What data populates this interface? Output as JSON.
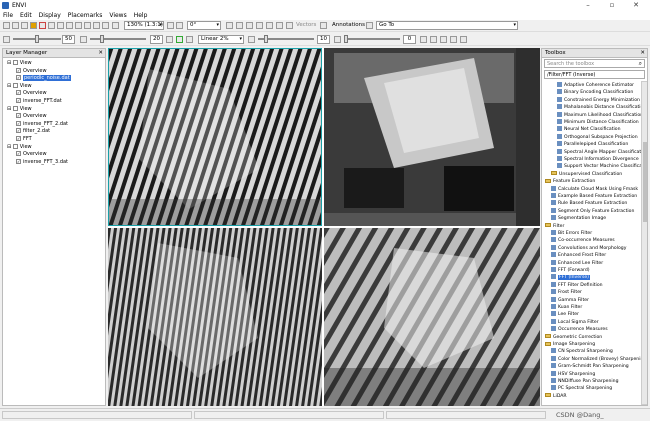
{
  "app": {
    "title": "ENVI"
  },
  "menu": [
    "File",
    "Edit",
    "Display",
    "Placemarks",
    "Views",
    "Help"
  ],
  "toolbar1": {
    "zoom": "130% (1.3:1)",
    "rotation": "0°",
    "vectors": "Vectors",
    "annotations": "Annotations",
    "goto": "Go To"
  },
  "toolbar2": {
    "brightness": "50",
    "contrast": "20",
    "stretch": "Linear 2%",
    "sharpen": "10",
    "transparency": "0"
  },
  "layer_manager": {
    "title": "Layer Manager",
    "rows": [
      {
        "indent": 0,
        "label": "View",
        "selected": false
      },
      {
        "indent": 1,
        "label": "Overview",
        "selected": false
      },
      {
        "indent": 1,
        "label": "periodic_noise.dat",
        "selected": true
      },
      {
        "indent": 0,
        "label": "View",
        "selected": false
      },
      {
        "indent": 1,
        "label": "Overview",
        "selected": false
      },
      {
        "indent": 1,
        "label": "inverse_FFT.dat",
        "selected": false
      },
      {
        "indent": 0,
        "label": "View",
        "selected": false
      },
      {
        "indent": 1,
        "label": "Overview",
        "selected": false
      },
      {
        "indent": 1,
        "label": "inverse_FFT_2.dat",
        "selected": false
      },
      {
        "indent": 1,
        "label": "filter_2.dat",
        "selected": false
      },
      {
        "indent": 1,
        "label": "FFT",
        "selected": false
      },
      {
        "indent": 0,
        "label": "View",
        "selected": false
      },
      {
        "indent": 1,
        "label": "Overview",
        "selected": false
      },
      {
        "indent": 1,
        "label": "inverse_FFT_3.dat",
        "selected": false
      }
    ]
  },
  "toolbox": {
    "title": "Toolbox",
    "search_placeholder": "Search the toolbox",
    "path": "/Filter/FFT (Inverse)",
    "items": [
      {
        "type": "tool",
        "indent": 2,
        "label": "Adaptive Coherence Estimator",
        "selected": false
      },
      {
        "type": "tool",
        "indent": 2,
        "label": "Binary Encoding Classification",
        "selected": false
      },
      {
        "type": "tool",
        "indent": 2,
        "label": "Constrained Energy Minimization",
        "selected": false
      },
      {
        "type": "tool",
        "indent": 2,
        "label": "Mahalanobis Distance Classification",
        "selected": false
      },
      {
        "type": "tool",
        "indent": 2,
        "label": "Maximum Likelihood Classification",
        "selected": false
      },
      {
        "type": "tool",
        "indent": 2,
        "label": "Minimum Distance Classification",
        "selected": false
      },
      {
        "type": "tool",
        "indent": 2,
        "label": "Neural Net Classification",
        "selected": false
      },
      {
        "type": "tool",
        "indent": 2,
        "label": "Orthogonal Subspace Projection",
        "selected": false
      },
      {
        "type": "tool",
        "indent": 2,
        "label": "Parallelepiped Classification",
        "selected": false
      },
      {
        "type": "tool",
        "indent": 2,
        "label": "Spectral Angle Mapper Classification",
        "selected": false
      },
      {
        "type": "tool",
        "indent": 2,
        "label": "Spectral Information Divergence",
        "selected": false
      },
      {
        "type": "tool",
        "indent": 2,
        "label": "Support Vector Machine Classification",
        "selected": false
      },
      {
        "type": "folder",
        "indent": 1,
        "label": "Unsupervised Classification",
        "selected": false
      },
      {
        "type": "folder",
        "indent": 0,
        "label": "Feature Extraction",
        "selected": false
      },
      {
        "type": "tool",
        "indent": 1,
        "label": "Calculate Cloud Mask Using Fmask",
        "selected": false
      },
      {
        "type": "tool",
        "indent": 1,
        "label": "Example Based Feature Extraction",
        "selected": false
      },
      {
        "type": "tool",
        "indent": 1,
        "label": "Rule Based Feature Extraction",
        "selected": false
      },
      {
        "type": "tool",
        "indent": 1,
        "label": "Segment Only Feature Extraction",
        "selected": false
      },
      {
        "type": "tool",
        "indent": 1,
        "label": "Segmentation Image",
        "selected": false
      },
      {
        "type": "folder",
        "indent": 0,
        "label": "Filter",
        "selected": false
      },
      {
        "type": "tool",
        "indent": 1,
        "label": "Bit Errors Filter",
        "selected": false
      },
      {
        "type": "tool",
        "indent": 1,
        "label": "Co-occurrence Measures",
        "selected": false
      },
      {
        "type": "tool",
        "indent": 1,
        "label": "Convolutions and Morphology",
        "selected": false
      },
      {
        "type": "tool",
        "indent": 1,
        "label": "Enhanced Frost Filter",
        "selected": false
      },
      {
        "type": "tool",
        "indent": 1,
        "label": "Enhanced Lee Filter",
        "selected": false
      },
      {
        "type": "tool",
        "indent": 1,
        "label": "FFT (Forward)",
        "selected": false
      },
      {
        "type": "tool",
        "indent": 1,
        "label": "FFT (Inverse)",
        "selected": true
      },
      {
        "type": "tool",
        "indent": 1,
        "label": "FFT Filter Definition",
        "selected": false
      },
      {
        "type": "tool",
        "indent": 1,
        "label": "Frost Filter",
        "selected": false
      },
      {
        "type": "tool",
        "indent": 1,
        "label": "Gamma Filter",
        "selected": false
      },
      {
        "type": "tool",
        "indent": 1,
        "label": "Kuan Filter",
        "selected": false
      },
      {
        "type": "tool",
        "indent": 1,
        "label": "Lee Filter",
        "selected": false
      },
      {
        "type": "tool",
        "indent": 1,
        "label": "Local Sigma Filter",
        "selected": false
      },
      {
        "type": "tool",
        "indent": 1,
        "label": "Occurrence Measures",
        "selected": false
      },
      {
        "type": "folder",
        "indent": 0,
        "label": "Geometric Correction",
        "selected": false
      },
      {
        "type": "folder",
        "indent": 0,
        "label": "Image Sharpening",
        "selected": false
      },
      {
        "type": "tool",
        "indent": 1,
        "label": "CN Spectral Sharpening",
        "selected": false
      },
      {
        "type": "tool",
        "indent": 1,
        "label": "Color Normalized (Brovey) Sharpening",
        "selected": false
      },
      {
        "type": "tool",
        "indent": 1,
        "label": "Gram-Schmidt Pan Sharpening",
        "selected": false
      },
      {
        "type": "tool",
        "indent": 1,
        "label": "HSV Sharpening",
        "selected": false
      },
      {
        "type": "tool",
        "indent": 1,
        "label": "NNDiffuse Pan Sharpening",
        "selected": false
      },
      {
        "type": "tool",
        "indent": 1,
        "label": "PC Spectral Sharpening",
        "selected": false
      },
      {
        "type": "folder",
        "indent": 0,
        "label": "LiDAR",
        "selected": false
      }
    ]
  },
  "watermark": "CSDN @Dang_"
}
